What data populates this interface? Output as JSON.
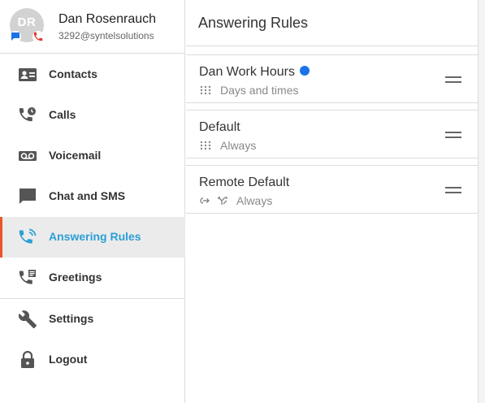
{
  "profile": {
    "initials": "DR",
    "name": "Dan Rosenrauch",
    "email": "3292@syntelsolutions"
  },
  "nav": {
    "contacts": "Contacts",
    "calls": "Calls",
    "voicemail": "Voicemail",
    "chat": "Chat and SMS",
    "answering_rules": "Answering Rules",
    "greetings": "Greetings",
    "settings": "Settings",
    "logout": "Logout"
  },
  "main": {
    "title": "Answering Rules",
    "rules": [
      {
        "name": "Dan Work Hours",
        "subtitle": "Days and times",
        "active": true
      },
      {
        "name": "Default",
        "subtitle": "Always",
        "active": false
      },
      {
        "name": "Remote Default",
        "subtitle": "Always",
        "active": false
      }
    ]
  },
  "colors": {
    "accent": "#2b9fd6",
    "active_border": "#e8552b",
    "active_dot": "#1a73e8",
    "chat_badge": "#1a73e8",
    "phone_badge": "#e53935"
  }
}
